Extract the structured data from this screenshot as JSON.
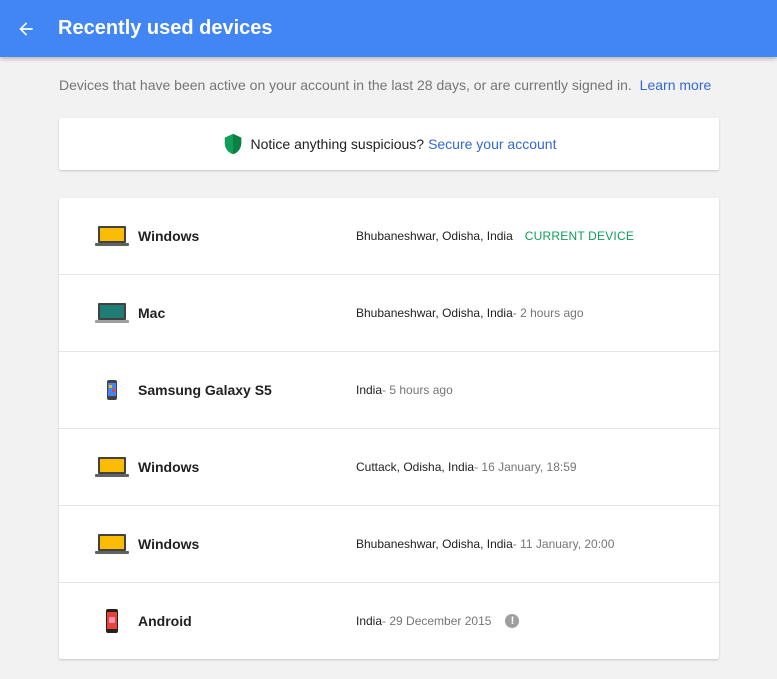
{
  "header": {
    "title": "Recently used devices",
    "bg_color": "#4285f4"
  },
  "intro": {
    "text": "Devices that have been active on your account in the last 28 days, or are currently signed in.",
    "link": "Learn more"
  },
  "notice": {
    "text": "Notice anything suspicious?",
    "link": "Secure your account"
  },
  "devices": [
    {
      "name": "Windows",
      "location": "Bhubaneshwar, Odisha, India",
      "time": "",
      "status": "CURRENT DEVICE",
      "icon": "laptop-windows-icon"
    },
    {
      "name": "Mac",
      "location": "Bhubaneshwar, Odisha, India",
      "time": " - 2 hours ago",
      "status": "",
      "icon": "laptop-mac-icon"
    },
    {
      "name": "Samsung Galaxy S5",
      "location": "India",
      "time": " - 5 hours ago",
      "status": "",
      "icon": "phone-samsung-icon"
    },
    {
      "name": "Windows",
      "location": "Cuttack, Odisha, India",
      "time": " - 16 January, 18:59",
      "status": "",
      "icon": "laptop-windows-icon"
    },
    {
      "name": "Windows",
      "location": "Bhubaneshwar, Odisha, India",
      "time": " - 11 January, 20:00",
      "status": "",
      "icon": "laptop-windows-icon"
    },
    {
      "name": "Android",
      "location": "India",
      "time": " - 29 December 2015",
      "status": "",
      "icon": "phone-android-icon",
      "warning": "!"
    }
  ]
}
